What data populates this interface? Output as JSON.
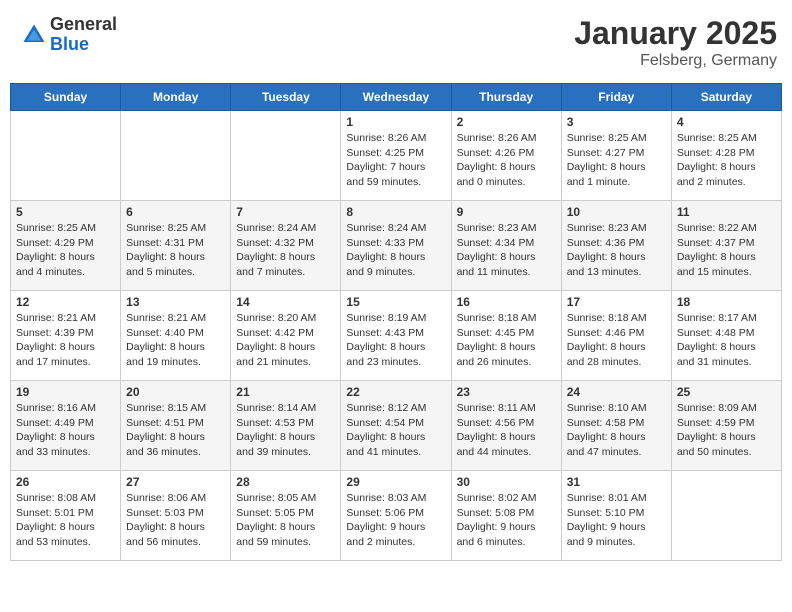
{
  "header": {
    "logo_general": "General",
    "logo_blue": "Blue",
    "month": "January 2025",
    "location": "Felsberg, Germany"
  },
  "days_of_week": [
    "Sunday",
    "Monday",
    "Tuesday",
    "Wednesday",
    "Thursday",
    "Friday",
    "Saturday"
  ],
  "weeks": [
    [
      {
        "day": "",
        "info": ""
      },
      {
        "day": "",
        "info": ""
      },
      {
        "day": "",
        "info": ""
      },
      {
        "day": "1",
        "info": "Sunrise: 8:26 AM\nSunset: 4:25 PM\nDaylight: 7 hours\nand 59 minutes."
      },
      {
        "day": "2",
        "info": "Sunrise: 8:26 AM\nSunset: 4:26 PM\nDaylight: 8 hours\nand 0 minutes."
      },
      {
        "day": "3",
        "info": "Sunrise: 8:25 AM\nSunset: 4:27 PM\nDaylight: 8 hours\nand 1 minute."
      },
      {
        "day": "4",
        "info": "Sunrise: 8:25 AM\nSunset: 4:28 PM\nDaylight: 8 hours\nand 2 minutes."
      }
    ],
    [
      {
        "day": "5",
        "info": "Sunrise: 8:25 AM\nSunset: 4:29 PM\nDaylight: 8 hours\nand 4 minutes."
      },
      {
        "day": "6",
        "info": "Sunrise: 8:25 AM\nSunset: 4:31 PM\nDaylight: 8 hours\nand 5 minutes."
      },
      {
        "day": "7",
        "info": "Sunrise: 8:24 AM\nSunset: 4:32 PM\nDaylight: 8 hours\nand 7 minutes."
      },
      {
        "day": "8",
        "info": "Sunrise: 8:24 AM\nSunset: 4:33 PM\nDaylight: 8 hours\nand 9 minutes."
      },
      {
        "day": "9",
        "info": "Sunrise: 8:23 AM\nSunset: 4:34 PM\nDaylight: 8 hours\nand 11 minutes."
      },
      {
        "day": "10",
        "info": "Sunrise: 8:23 AM\nSunset: 4:36 PM\nDaylight: 8 hours\nand 13 minutes."
      },
      {
        "day": "11",
        "info": "Sunrise: 8:22 AM\nSunset: 4:37 PM\nDaylight: 8 hours\nand 15 minutes."
      }
    ],
    [
      {
        "day": "12",
        "info": "Sunrise: 8:21 AM\nSunset: 4:39 PM\nDaylight: 8 hours\nand 17 minutes."
      },
      {
        "day": "13",
        "info": "Sunrise: 8:21 AM\nSunset: 4:40 PM\nDaylight: 8 hours\nand 19 minutes."
      },
      {
        "day": "14",
        "info": "Sunrise: 8:20 AM\nSunset: 4:42 PM\nDaylight: 8 hours\nand 21 minutes."
      },
      {
        "day": "15",
        "info": "Sunrise: 8:19 AM\nSunset: 4:43 PM\nDaylight: 8 hours\nand 23 minutes."
      },
      {
        "day": "16",
        "info": "Sunrise: 8:18 AM\nSunset: 4:45 PM\nDaylight: 8 hours\nand 26 minutes."
      },
      {
        "day": "17",
        "info": "Sunrise: 8:18 AM\nSunset: 4:46 PM\nDaylight: 8 hours\nand 28 minutes."
      },
      {
        "day": "18",
        "info": "Sunrise: 8:17 AM\nSunset: 4:48 PM\nDaylight: 8 hours\nand 31 minutes."
      }
    ],
    [
      {
        "day": "19",
        "info": "Sunrise: 8:16 AM\nSunset: 4:49 PM\nDaylight: 8 hours\nand 33 minutes."
      },
      {
        "day": "20",
        "info": "Sunrise: 8:15 AM\nSunset: 4:51 PM\nDaylight: 8 hours\nand 36 minutes."
      },
      {
        "day": "21",
        "info": "Sunrise: 8:14 AM\nSunset: 4:53 PM\nDaylight: 8 hours\nand 39 minutes."
      },
      {
        "day": "22",
        "info": "Sunrise: 8:12 AM\nSunset: 4:54 PM\nDaylight: 8 hours\nand 41 minutes."
      },
      {
        "day": "23",
        "info": "Sunrise: 8:11 AM\nSunset: 4:56 PM\nDaylight: 8 hours\nand 44 minutes."
      },
      {
        "day": "24",
        "info": "Sunrise: 8:10 AM\nSunset: 4:58 PM\nDaylight: 8 hours\nand 47 minutes."
      },
      {
        "day": "25",
        "info": "Sunrise: 8:09 AM\nSunset: 4:59 PM\nDaylight: 8 hours\nand 50 minutes."
      }
    ],
    [
      {
        "day": "26",
        "info": "Sunrise: 8:08 AM\nSunset: 5:01 PM\nDaylight: 8 hours\nand 53 minutes."
      },
      {
        "day": "27",
        "info": "Sunrise: 8:06 AM\nSunset: 5:03 PM\nDaylight: 8 hours\nand 56 minutes."
      },
      {
        "day": "28",
        "info": "Sunrise: 8:05 AM\nSunset: 5:05 PM\nDaylight: 8 hours\nand 59 minutes."
      },
      {
        "day": "29",
        "info": "Sunrise: 8:03 AM\nSunset: 5:06 PM\nDaylight: 9 hours\nand 2 minutes."
      },
      {
        "day": "30",
        "info": "Sunrise: 8:02 AM\nSunset: 5:08 PM\nDaylight: 9 hours\nand 6 minutes."
      },
      {
        "day": "31",
        "info": "Sunrise: 8:01 AM\nSunset: 5:10 PM\nDaylight: 9 hours\nand 9 minutes."
      },
      {
        "day": "",
        "info": ""
      }
    ]
  ]
}
